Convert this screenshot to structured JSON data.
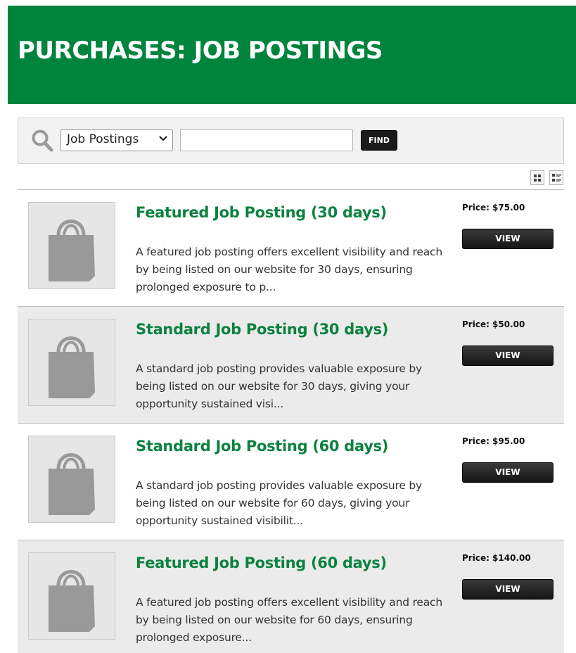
{
  "header": {
    "title": "PURCHASES: JOB POSTINGS"
  },
  "search": {
    "category_selected": "Job Postings",
    "query_value": "",
    "find_label": "FIND"
  },
  "icons": {
    "search": "search-icon",
    "grid_view": "grid-view-icon",
    "list_view": "list-view-icon",
    "product_placeholder": "shopping-bag-icon"
  },
  "colors": {
    "header_bg": "#00843d",
    "title_green": "#0c8240",
    "button_dark": "#1a1a1a"
  },
  "products": [
    {
      "title": "Featured Job Posting (30 days)",
      "description": "A featured job posting offers excellent visibility and reach by being listed on our website for 30 days, ensuring prolonged exposure to p...",
      "price": "Price: $75.00",
      "view_label": "VIEW"
    },
    {
      "title": "Standard Job Posting (30 days)",
      "description": "A standard job posting provides valuable exposure by being listed on our website for 30 days, giving your opportunity sustained visi...",
      "price": "Price: $50.00",
      "view_label": "VIEW"
    },
    {
      "title": "Standard Job Posting (60 days)",
      "description": "A standard job posting provides valuable exposure by being listed on our website for 60 days, giving your opportunity sustained visibilit...",
      "price": "Price: $95.00",
      "view_label": "VIEW"
    },
    {
      "title": "Featured Job Posting (60 days)",
      "description": "A featured job posting offers excellent visibility and reach by being listed on our website for 60 days, ensuring prolonged exposure...",
      "price": "Price: $140.00",
      "view_label": "VIEW"
    }
  ]
}
